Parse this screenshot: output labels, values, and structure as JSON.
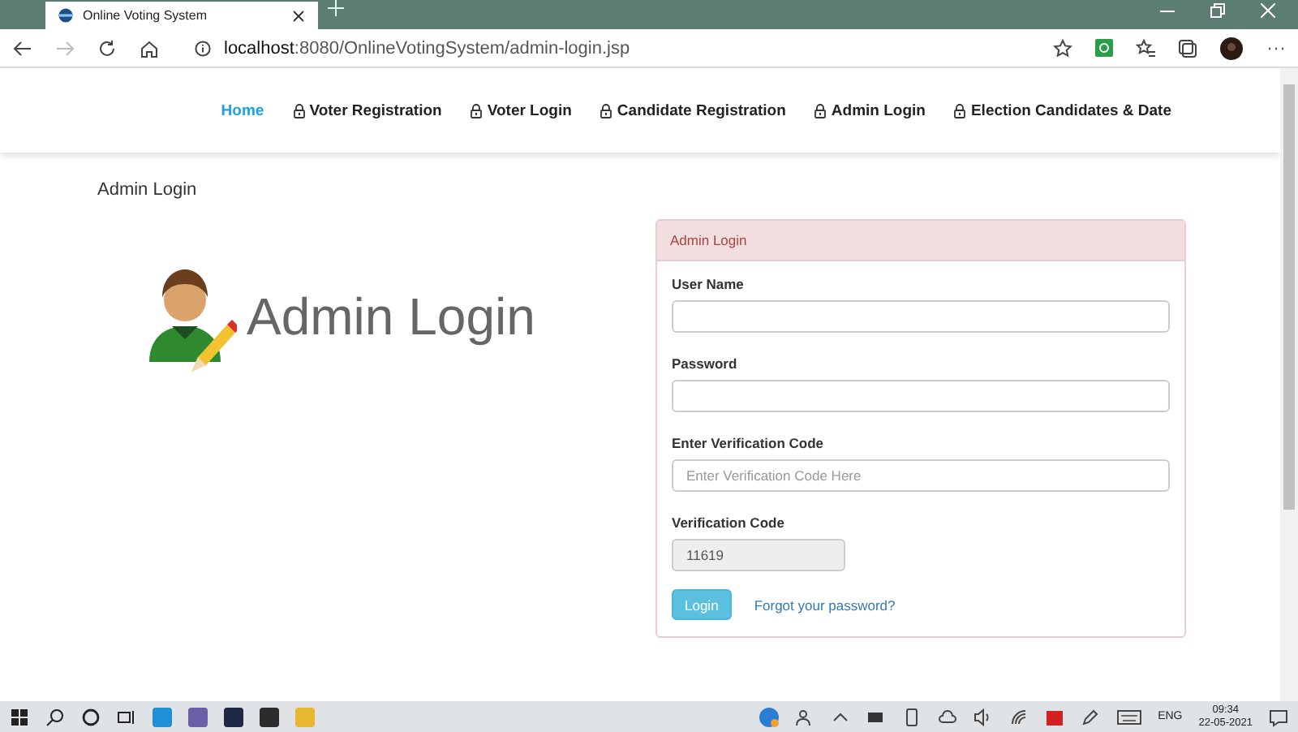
{
  "browser": {
    "tab_title": "Online Voting System",
    "url_host": "localhost",
    "url_rest": ":8080/OnlineVotingSystem/admin-login.jsp"
  },
  "nav": [
    {
      "label": "Home",
      "selected": true,
      "locked": false
    },
    {
      "label": "Voter Registration",
      "selected": false,
      "locked": true
    },
    {
      "label": "Voter Login",
      "selected": false,
      "locked": true
    },
    {
      "label": "Candidate Registration",
      "selected": false,
      "locked": true
    },
    {
      "label": "Admin Login",
      "selected": false,
      "locked": true
    },
    {
      "label": "Election Candidates & Date",
      "selected": false,
      "locked": true
    }
  ],
  "page_title": "Admin Login",
  "banner": {
    "title": "Admin Login"
  },
  "panel": {
    "heading": "Admin Login",
    "fields": [
      {
        "label": "User Name",
        "disabled": false
      },
      {
        "label": "Password",
        "disabled": false
      },
      {
        "label": "Enter Verification Code",
        "placeholder": "Enter Verification Code Here",
        "disabled": false
      },
      {
        "label": "Verification Code",
        "value": "11619",
        "disabled": true
      }
    ],
    "login_button": "Login",
    "forgot_link": "Forgot your password?"
  },
  "taskbar": {
    "language": "ENG",
    "time": "09:34",
    "date": "22-05-2021"
  }
}
